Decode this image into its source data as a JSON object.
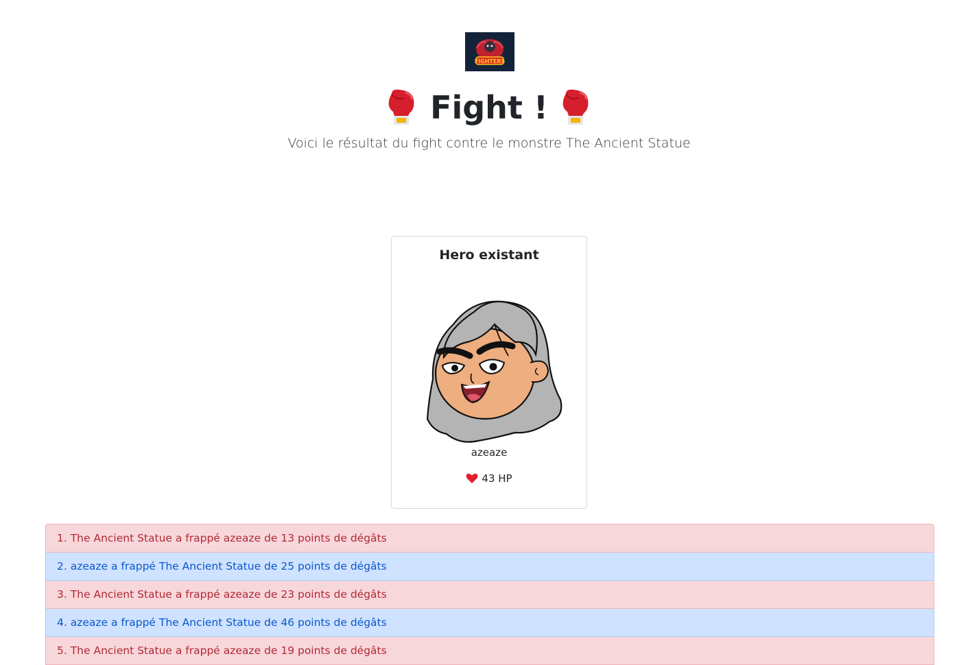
{
  "logo": {
    "alt_text": "FIGHTERS",
    "icon": "fighters-logo"
  },
  "header": {
    "title": "Fight !",
    "title_icon": "boxing-glove-icon",
    "subtitle": "Voici le résultat du fight contre le monstre The Ancient Statue"
  },
  "hero_card": {
    "title": "Hero existant",
    "name": "azeaze",
    "hp_text": "43 HP",
    "hp_icon": "heart-icon"
  },
  "fight_log": [
    {
      "text": "1. The Ancient Statue a frappé azeaze de 13 points de dégâts",
      "attacker": "monster"
    },
    {
      "text": "2. azeaze a frappé The Ancient Statue de 25 points de dégâts",
      "attacker": "hero"
    },
    {
      "text": "3. The Ancient Statue a frappé azeaze de 23 points de dégâts",
      "attacker": "monster"
    },
    {
      "text": "4. azeaze a frappé The Ancient Statue de 46 points de dégâts",
      "attacker": "hero"
    },
    {
      "text": "5. The Ancient Statue a frappé azeaze de 19 points de dégâts",
      "attacker": "monster"
    }
  ],
  "colors": {
    "monster_bg": "#f8d7da",
    "monster_text": "#b02a37",
    "hero_bg": "#cfe2ff",
    "hero_text": "#0a58ca",
    "logo_bg": "#13233a"
  }
}
